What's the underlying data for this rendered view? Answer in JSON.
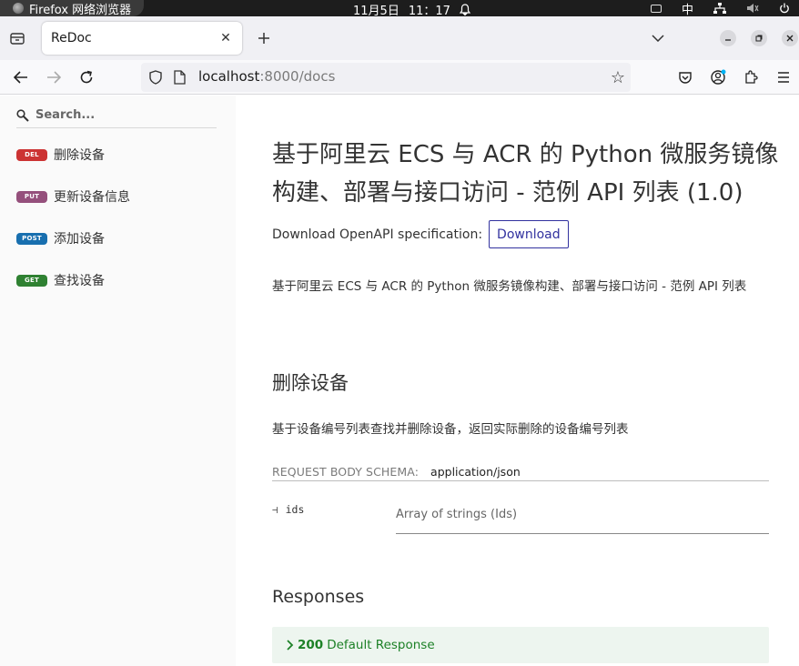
{
  "os": {
    "app_name": "Firefox 网络浏览器",
    "date": "11月5日",
    "time": "11：17",
    "ime": "中"
  },
  "browser": {
    "tab_title": "ReDoc",
    "url_host": "localhost",
    "url_rest": ":8000/docs"
  },
  "sidebar": {
    "search_placeholder": "Search...",
    "items": [
      {
        "method": "DEL",
        "label": "删除设备",
        "color": "#cc3333"
      },
      {
        "method": "PUT",
        "label": "更新设备信息",
        "color": "#95507c"
      },
      {
        "method": "POST",
        "label": "添加设备",
        "color": "#186fAF"
      },
      {
        "method": "GET",
        "label": "查找设备",
        "color": "#2F8132"
      }
    ]
  },
  "main": {
    "title": "基于阿里云 ECS 与 ACR 的 Python 微服务镜像构建、部署与接口访问 - 范例 API 列表 (1.0)",
    "download_label": "Download OpenAPI specification:",
    "download_button": "Download",
    "description": "基于阿里云 ECS 与 ACR 的 Python 微服务镜像构建、部署与接口访问 - 范例 API 列表",
    "operation": {
      "title": "删除设备",
      "description": "基于设备编号列表查找并删除设备，返回实际删除的设备编号列表",
      "schema_label": "REQUEST BODY SCHEMA:",
      "schema_type": "application/json",
      "param_name": "ids",
      "param_type": "Array of strings (Ids)"
    },
    "responses": {
      "title": "Responses",
      "code": "200",
      "label": "Default Response"
    }
  },
  "colors": {
    "accent": "#32329f",
    "response_green": "#1d8127",
    "response_bg": "#edf5ef"
  }
}
